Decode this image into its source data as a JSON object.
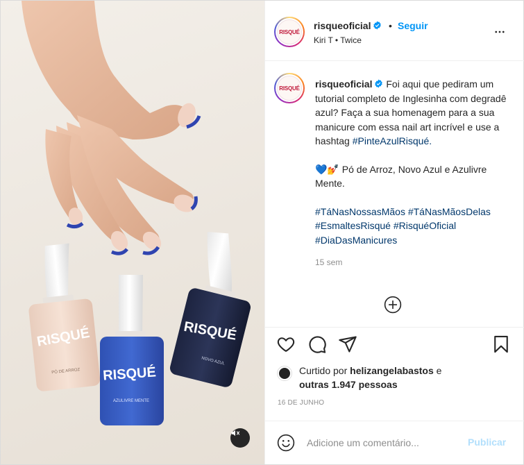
{
  "header": {
    "username": "risqueoficial",
    "avatar_text": "RISQUÉ",
    "separator": "•",
    "follow_label": "Seguir",
    "audio": "Kiri T • Twice"
  },
  "caption": {
    "username": "risqueoficial",
    "text1": "Foi aqui que pediram um tutorial completo de Inglesinha com degradê azul? Faça a sua homenagem para a sua manicure com essa nail art incrível e use a hashtag",
    "hashtag1": "#PinteAzulRisqué.",
    "emojis": "💙💅",
    "text2": "Pó de Arroz, Novo Azul e Azulivre Mente.",
    "hashtags": [
      "#TáNasNossasMãos",
      "#TáNasMãosDelas",
      "#EsmaltesRisqué",
      "#RisquéOficial",
      "#DiaDasManicures"
    ],
    "time": "15 sem"
  },
  "product_labels": {
    "brand": "RISQUÉ",
    "bottle1": "PÓ DE ARROZ",
    "bottle2": "AZULIVRE MENTE",
    "bottle3": "NOVO AZUL"
  },
  "likes": {
    "prefix": "Curtido por",
    "user": "helizangelabastos",
    "suffix": "e",
    "others": "outras 1.947 pessoas"
  },
  "date": "16 DE JUNHO",
  "composer": {
    "placeholder": "Adicione um comentário...",
    "publish_label": "Publicar"
  },
  "colors": {
    "accent": "#0095f6",
    "publish_disabled": "#b2dffc",
    "hashtag": "#00376b",
    "muted": "#8e8e8e",
    "nail_blue": "#2b3fa8"
  },
  "icons": [
    "verified-icon",
    "more-icon",
    "load-more-icon",
    "heart-icon",
    "comment-icon",
    "share-icon",
    "bookmark-icon",
    "emoji-icon",
    "mute-icon"
  ]
}
